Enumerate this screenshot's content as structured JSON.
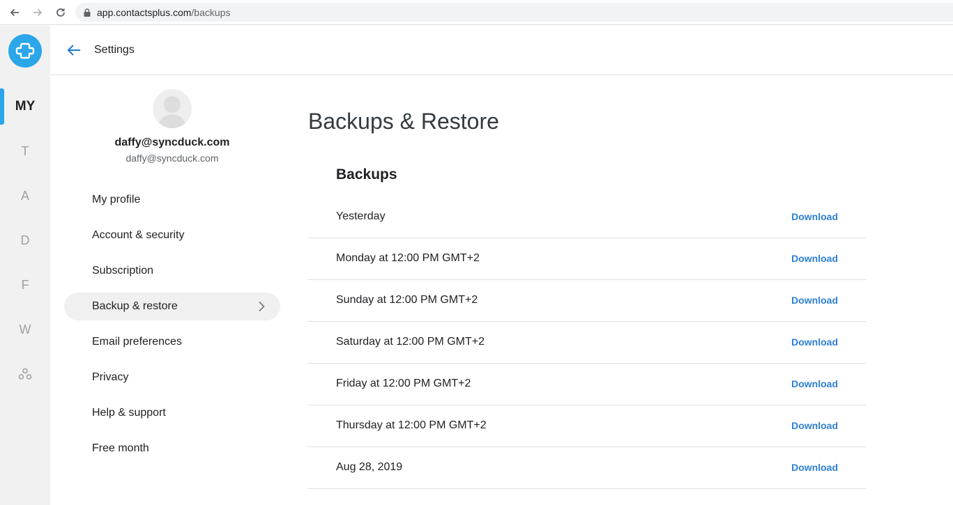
{
  "browser": {
    "url_host": "app.contactsplus.com",
    "url_path": "/backups"
  },
  "rail": {
    "items": [
      "MY",
      "T",
      "A",
      "D",
      "F",
      "W"
    ]
  },
  "header": {
    "title": "Settings"
  },
  "user": {
    "name": "daffy@syncduck.com",
    "email": "daffy@syncduck.com"
  },
  "menu": {
    "items": [
      {
        "label": "My profile"
      },
      {
        "label": "Account & security"
      },
      {
        "label": "Subscription"
      },
      {
        "label": "Backup & restore"
      },
      {
        "label": "Email preferences"
      },
      {
        "label": "Privacy"
      },
      {
        "label": "Help & support"
      },
      {
        "label": "Free month"
      }
    ],
    "active_index": 3
  },
  "content": {
    "title": "Backups & Restore",
    "section": "Backups",
    "download_label": "Download",
    "backups": [
      {
        "label": "Yesterday"
      },
      {
        "label": "Monday at 12:00 PM GMT+2"
      },
      {
        "label": "Sunday at 12:00 PM GMT+2"
      },
      {
        "label": "Saturday at 12:00 PM GMT+2"
      },
      {
        "label": "Friday at 12:00 PM GMT+2"
      },
      {
        "label": "Thursday at 12:00 PM GMT+2"
      },
      {
        "label": "Aug 28, 2019"
      }
    ]
  },
  "colors": {
    "accent": "#2ba6e8",
    "link": "#2d7fcf",
    "rail_bg": "#f1f1f1"
  }
}
